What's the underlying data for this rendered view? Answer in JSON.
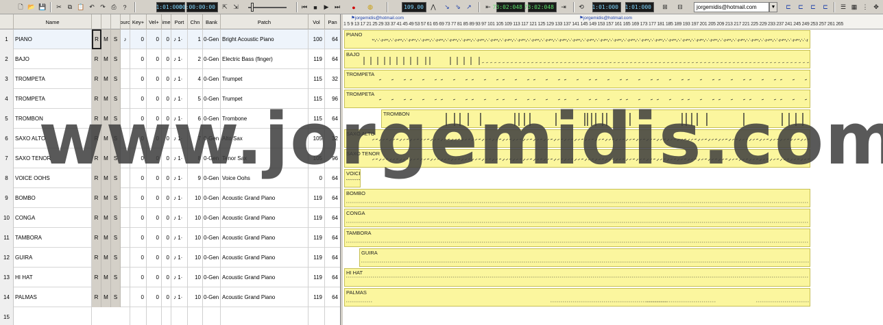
{
  "toolbar": {
    "time_now": "1:01:000",
    "time_clock": "00:00:00:00",
    "tempo": "109.00",
    "lcd_left": "73:02:048",
    "lcd_right": "73:02:048",
    "loop_start": "1:01:000",
    "loop_end": "1:01:000",
    "email": "jorgemidis@hotmail.com"
  },
  "columns": {
    "name": "Name",
    "source": "ourc",
    "key": "Key+",
    "vel": "Vel+",
    "time": "ime",
    "port": "Port",
    "chn": "Chn",
    "bank": "Bank",
    "patch": "Patch",
    "vol": "Vol",
    "pan": "Pan"
  },
  "tracks": [
    {
      "num": "1",
      "name": "PIANO",
      "key": "0",
      "vel": "0",
      "time": "0",
      "port": "♪ 1·",
      "chn": "1",
      "bank": "0-Gen",
      "patch": "Bright Acoustic Piano",
      "vol": "100",
      "pan": "64",
      "src": "♪"
    },
    {
      "num": "2",
      "name": "BAJO",
      "key": "0",
      "vel": "0",
      "time": "0",
      "port": "♪ 1·",
      "chn": "2",
      "bank": "0-Gen",
      "patch": "Electric Bass (finger)",
      "vol": "119",
      "pan": "64",
      "src": ""
    },
    {
      "num": "3",
      "name": "TROMPETA",
      "key": "0",
      "vel": "0",
      "time": "0",
      "port": "♪ 1·",
      "chn": "4",
      "bank": "0-Gen",
      "patch": "Trumpet",
      "vol": "115",
      "pan": "32",
      "src": ""
    },
    {
      "num": "4",
      "name": "TROMPETA",
      "key": "0",
      "vel": "0",
      "time": "0",
      "port": "♪ 1·",
      "chn": "5",
      "bank": "0-Gen",
      "patch": "Trumpet",
      "vol": "115",
      "pan": "96",
      "src": ""
    },
    {
      "num": "5",
      "name": "TROMBON",
      "key": "0",
      "vel": "0",
      "time": "0",
      "port": "♪ 1·",
      "chn": "6",
      "bank": "0-Gen",
      "patch": "Trombone",
      "vol": "115",
      "pan": "64",
      "src": ""
    },
    {
      "num": "6",
      "name": "SAXO ALTO",
      "key": "0",
      "vel": "0",
      "time": "0",
      "port": "♪ 1·",
      "chn": "7",
      "bank": "0-Gen",
      "patch": "Alto Sax",
      "vol": "105",
      "pan": "32",
      "src": ""
    },
    {
      "num": "7",
      "name": "SAXO TENOR",
      "key": "0",
      "vel": "0",
      "time": "0",
      "port": "♪ 1·",
      "chn": "8",
      "bank": "0-Gen",
      "patch": "Tenor Sax",
      "vol": "105",
      "pan": "96",
      "src": ""
    },
    {
      "num": "8",
      "name": "VOICE OOHS",
      "key": "0",
      "vel": "0",
      "time": "0",
      "port": "♪ 1·",
      "chn": "9",
      "bank": "0-Gen",
      "patch": "Voice Oohs",
      "vol": "0",
      "pan": "64",
      "src": ""
    },
    {
      "num": "9",
      "name": "BOMBO",
      "key": "0",
      "vel": "0",
      "time": "0",
      "port": "♪ 1·",
      "chn": "10",
      "bank": "0-Gen",
      "patch": "Acoustic Grand Piano",
      "vol": "119",
      "pan": "64",
      "src": ""
    },
    {
      "num": "10",
      "name": "CONGA",
      "key": "0",
      "vel": "0",
      "time": "0",
      "port": "♪ 1·",
      "chn": "10",
      "bank": "0-Gen",
      "patch": "Acoustic Grand Piano",
      "vol": "119",
      "pan": "64",
      "src": ""
    },
    {
      "num": "11",
      "name": "TAMBORA",
      "key": "0",
      "vel": "0",
      "time": "0",
      "port": "♪ 1·",
      "chn": "10",
      "bank": "0-Gen",
      "patch": "Acoustic Grand Piano",
      "vol": "119",
      "pan": "64",
      "src": ""
    },
    {
      "num": "12",
      "name": "GUIRA",
      "key": "0",
      "vel": "0",
      "time": "0",
      "port": "♪ 1·",
      "chn": "10",
      "bank": "0-Gen",
      "patch": "Acoustic Grand Piano",
      "vol": "119",
      "pan": "64",
      "src": ""
    },
    {
      "num": "13",
      "name": "HI HAT",
      "key": "0",
      "vel": "0",
      "time": "0",
      "port": "♪ 1·",
      "chn": "10",
      "bank": "0-Gen",
      "patch": "Acoustic Grand Piano",
      "vol": "119",
      "pan": "64",
      "src": ""
    },
    {
      "num": "14",
      "name": "PALMAS",
      "key": "0",
      "vel": "0",
      "time": "0",
      "port": "♪ 1·",
      "chn": "10",
      "bank": "0-Gen",
      "patch": "Acoustic Grand Piano",
      "vol": "119",
      "pan": "64",
      "src": ""
    },
    {
      "num": "15",
      "name": "",
      "key": "",
      "vel": "",
      "time": "",
      "port": "",
      "chn": "",
      "bank": "",
      "patch": "",
      "vol": "",
      "pan": "",
      "src": ""
    }
  ],
  "timeline": {
    "marker_a": "jorgemidis@hotmail.com",
    "marker_b": "jorgemidis@hotmail.com",
    "ruler_text": "1 5 9 13 17 21 25 29 33 37 41 45 49 53 57 61 65 69 73 77 81 85 89 93 97 101 105 109 113 117 121 125 129 133 137 141 145 149 153 157 161 165 169 173 177 181 185 189 193 197 201 205 209 213 217 221 225 229 233 237 241 245 249 253 257 261 265"
  },
  "watermark": "www.jorgemidis.com"
}
